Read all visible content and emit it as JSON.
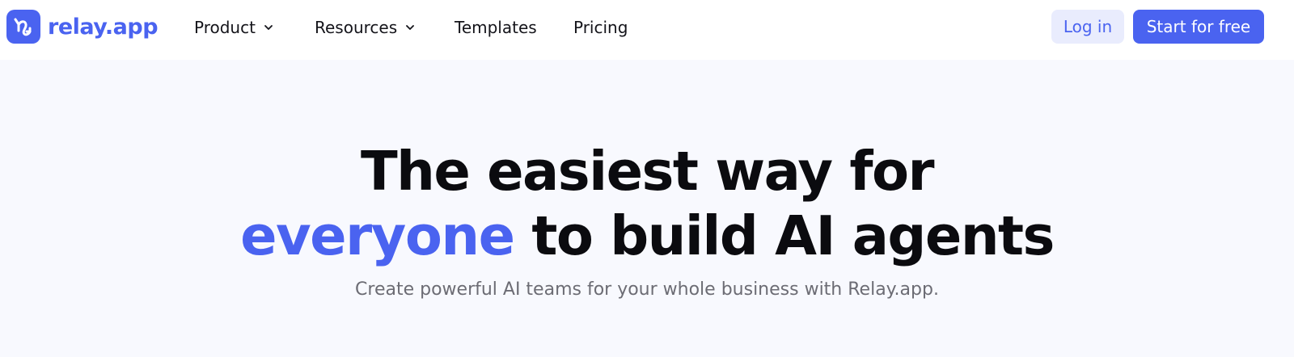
{
  "brand": {
    "name": "relay.app",
    "accent_color": "#4a63f0"
  },
  "nav": {
    "items": [
      {
        "label": "Product",
        "has_dropdown": true
      },
      {
        "label": "Resources",
        "has_dropdown": true
      },
      {
        "label": "Templates",
        "has_dropdown": false
      },
      {
        "label": "Pricing",
        "has_dropdown": false
      }
    ]
  },
  "header_actions": {
    "login_label": "Log in",
    "start_label": "Start for free"
  },
  "hero": {
    "title_line1": "The easiest way for",
    "title_line2_accent": "everyone",
    "title_line2_rest": " to build AI agents",
    "subtitle": "Create powerful AI teams for your whole business with Relay.app."
  },
  "colors": {
    "page_background": "#f8f9fe",
    "header_background": "#ffffff",
    "login_button_background": "#e9ecfd",
    "headline": "#0b0b0f",
    "subtitle": "#6c6c74"
  }
}
